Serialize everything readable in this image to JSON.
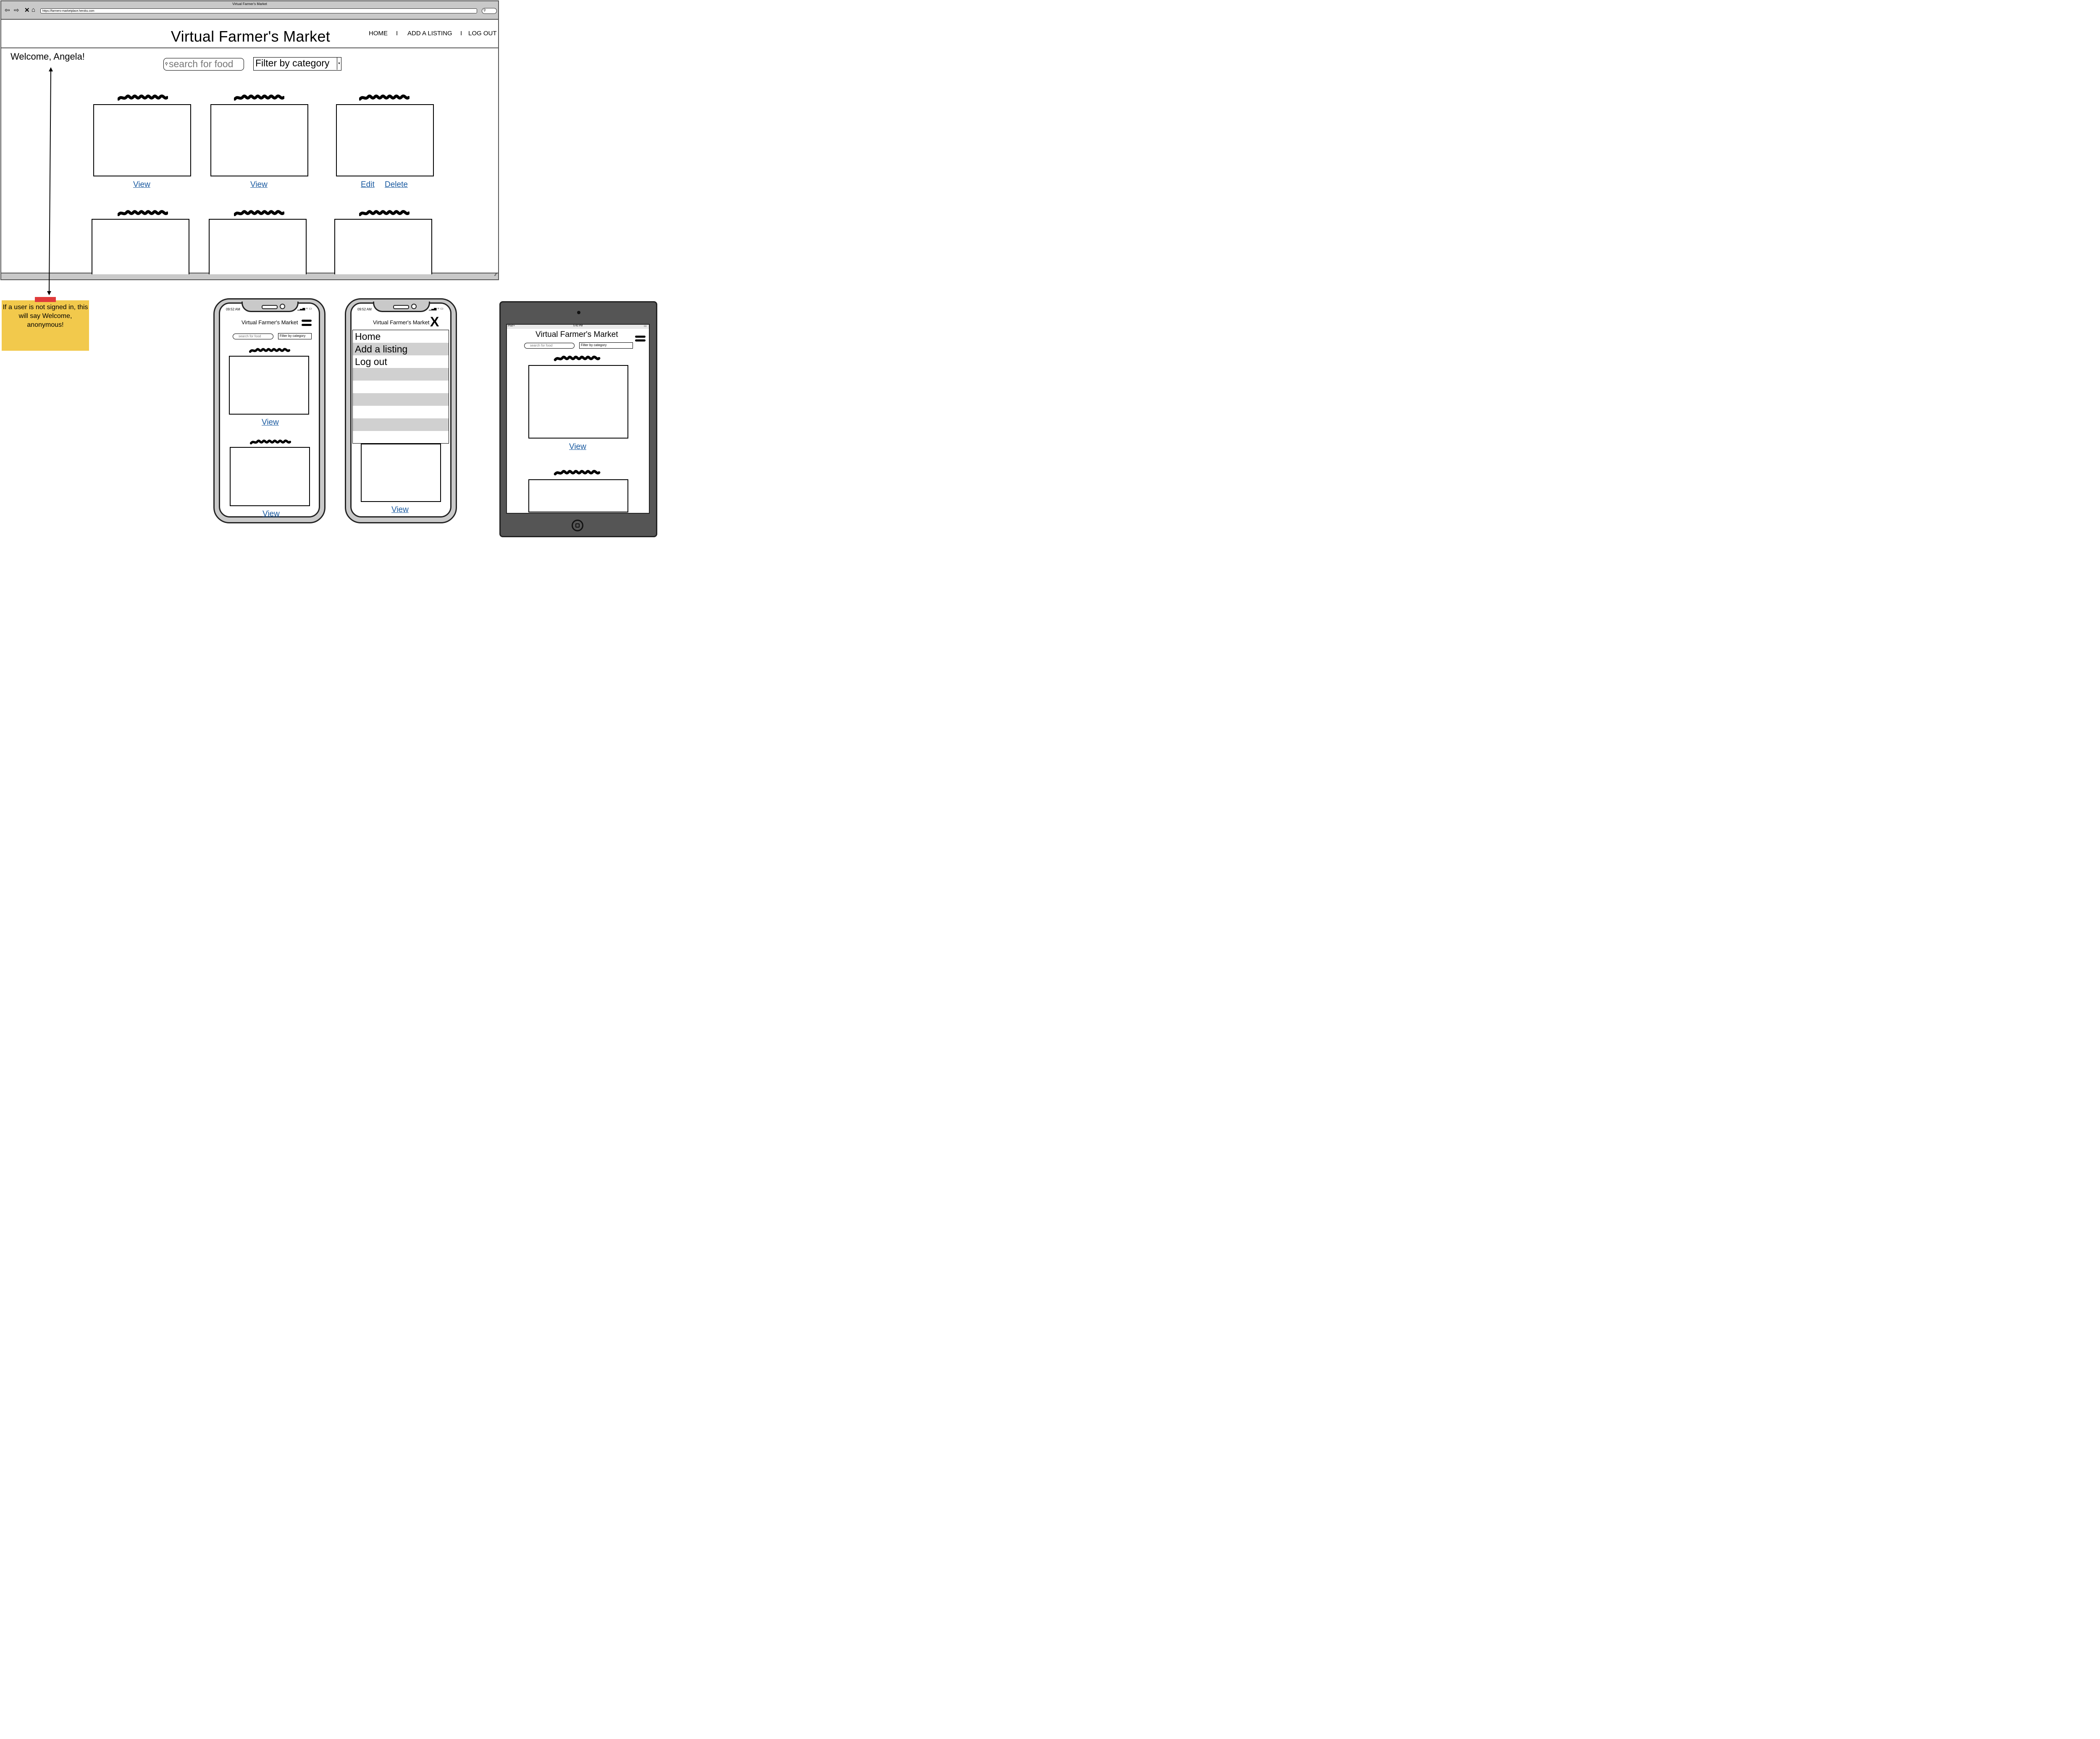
{
  "browser": {
    "window_title": "Virtual Farmer's Market",
    "url": "https://farmers-marketplace.heroku.com"
  },
  "site": {
    "title": "Virtual Farmer's Market",
    "nav": {
      "home": "HOME",
      "add_listing": "ADD A LISTING",
      "logout": "LOG OUT",
      "separator": "I"
    },
    "welcome": "Welcome, Angela!",
    "search_placeholder": "search for food",
    "filter_label": "Filter by category",
    "card_links": {
      "view": "View",
      "edit": "Edit",
      "delete": "Delete"
    }
  },
  "sticky_note": {
    "text": "If a user is not signed in, this will say Welcome, anonymous!"
  },
  "mobile": {
    "time": "09:52 AM",
    "title": "Virtual Farmer's Market",
    "search_placeholder": "search for food",
    "filter_label": "Filter by category",
    "view": "View",
    "menu": {
      "close": "X",
      "items": [
        "Home",
        "Add a listing",
        "Log out"
      ]
    }
  },
  "tablet": {
    "device": "iPad",
    "time": "5:42 PM",
    "title": "Virtual Farmer's Market",
    "search_placeholder": "search for food",
    "filter_label": "Filter by category",
    "view": "View"
  },
  "icons": [
    "back-arrow-icon",
    "forward-arrow-icon",
    "close-icon",
    "home-icon",
    "search-icon",
    "hamburger-menu-icon",
    "dropdown-arrow-icon",
    "signal-icon",
    "wifi-icon",
    "battery-icon",
    "home-button-icon",
    "resize-grip-icon"
  ]
}
